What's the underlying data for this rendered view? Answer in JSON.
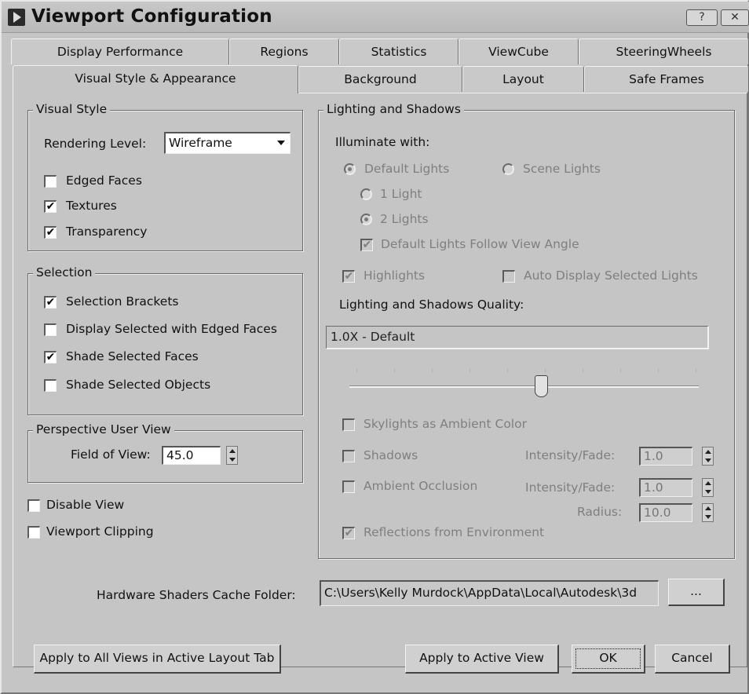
{
  "window": {
    "title": "Viewport Configuration",
    "help_label": "?",
    "close_label": "✕"
  },
  "tabs_row1": [
    "Display Performance",
    "Regions",
    "Statistics",
    "ViewCube",
    "SteeringWheels"
  ],
  "tabs_row2": [
    "Visual Style & Appearance",
    "Background",
    "Layout",
    "Safe Frames"
  ],
  "active_tab": "Visual Style & Appearance",
  "visual_style": {
    "title": "Visual Style",
    "rendering_level_label": "Rendering Level:",
    "rendering_level_value": "Wireframe",
    "edged_faces": {
      "label": "Edged Faces",
      "checked": false
    },
    "textures": {
      "label": "Textures",
      "checked": true
    },
    "transparency": {
      "label": "Transparency",
      "checked": true
    }
  },
  "selection": {
    "title": "Selection",
    "selection_brackets": {
      "label": "Selection Brackets",
      "checked": true
    },
    "display_selected_edged": {
      "label": "Display Selected with Edged Faces",
      "checked": false
    },
    "shade_selected_faces": {
      "label": "Shade Selected Faces",
      "checked": true
    },
    "shade_selected_objects": {
      "label": "Shade Selected Objects",
      "checked": false
    }
  },
  "perspective": {
    "title": "Perspective User View",
    "fov_label": "Field of View:",
    "fov_value": "45.0"
  },
  "disable_view": {
    "label": "Disable View",
    "checked": false
  },
  "viewport_clipping": {
    "label": "Viewport Clipping",
    "checked": false
  },
  "lighting": {
    "title": "Lighting and Shadows",
    "illuminate_label": "Illuminate with:",
    "default_lights": "Default Lights",
    "scene_lights": "Scene Lights",
    "one_light": "1 Light",
    "two_lights": "2 Lights",
    "follow_view": "Default Lights Follow View Angle",
    "highlights": "Highlights",
    "auto_display": "Auto Display Selected Lights",
    "quality_label": "Lighting and Shadows Quality:",
    "quality_value": "1.0X - Default",
    "quality_slider_fraction": 0.55,
    "skylights": "Skylights as Ambient Color",
    "shadows": "Shadows",
    "shadows_intensity_label": "Intensity/Fade:",
    "shadows_intensity_value": "1.0",
    "ambient_occlusion": "Ambient Occlusion",
    "ao_intensity_label": "Intensity/Fade:",
    "ao_intensity_value": "1.0",
    "radius_label": "Radius:",
    "radius_value": "10.0",
    "reflections": "Reflections from Environment"
  },
  "cache": {
    "label": "Hardware Shaders Cache Folder:",
    "path": "C:\\Users\\Kelly Murdock\\AppData\\Local\\Autodesk\\3d",
    "browse_label": "..."
  },
  "buttons": {
    "apply_all": "Apply to All Views in Active Layout Tab",
    "apply_active": "Apply to Active View",
    "ok": "OK",
    "cancel": "Cancel"
  }
}
